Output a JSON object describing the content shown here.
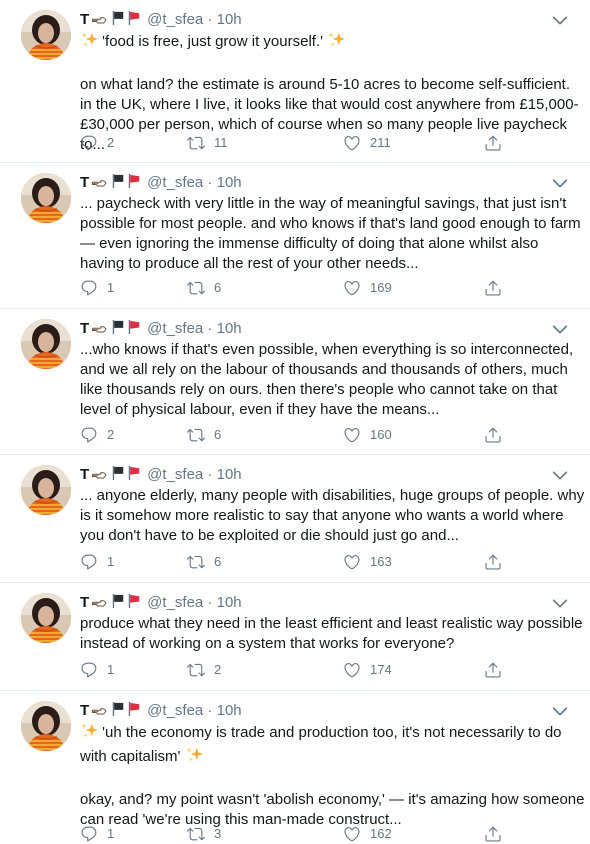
{
  "colors": {
    "text": "#14171a",
    "muted": "#657786",
    "divider": "#e6ecf0",
    "sparkle": "#ffcc4d",
    "flag_red": "#dd2e44",
    "flag_black": "#292f33"
  },
  "icons": {
    "reply": "reply-icon",
    "retweet": "retweet-icon",
    "like": "heart-icon",
    "share": "share-icon",
    "menu": "chevron-down-icon",
    "name_emoji": [
      "shooting-hand-emoji",
      "black-flag-emoji",
      "red-flag-emoji"
    ],
    "inline_emoji": "sparkles-emoji"
  },
  "tweets": [
    {
      "name": "T",
      "handle": "@t_sfea",
      "dot": "·",
      "time": "10h",
      "paragraphs": [
        "'food is free, just grow it yourself.'",
        "on what land? the estimate is around 5-10 acres to become self-sufficient. in the UK, where I live, it looks like that would cost anywhere from £15,000-£30,000 per person, which of course when so many people live paycheck to..."
      ],
      "replies": "2",
      "retweets": "11",
      "likes": "211"
    },
    {
      "name": "T",
      "handle": "@t_sfea",
      "dot": "·",
      "time": "10h",
      "paragraphs": [
        "... paycheck with very little in the way of meaningful savings, that just isn't possible for most people. and who knows if that's land good enough to farm — even ignoring the immense difficulty of doing that alone whilst also having to produce all the rest of your other needs..."
      ],
      "replies": "1",
      "retweets": "6",
      "likes": "169"
    },
    {
      "name": "T",
      "handle": "@t_sfea",
      "dot": "·",
      "time": "10h",
      "paragraphs": [
        "...who knows if that's even possible, when everything is so interconnected, and we all rely on the labour of thousands and thousands of others, much like thousands rely on ours. then there's people who cannot take on that level of physical labour, even if they have the means..."
      ],
      "replies": "2",
      "retweets": "6",
      "likes": "160"
    },
    {
      "name": "T",
      "handle": "@t_sfea",
      "dot": "·",
      "time": "10h",
      "paragraphs": [
        "... anyone elderly, many people with disabilities, huge groups of people. why is it somehow more realistic to say that anyone who wants a world where you don't have to be exploited or die should just go and..."
      ],
      "replies": "1",
      "retweets": "6",
      "likes": "163"
    },
    {
      "name": "T",
      "handle": "@t_sfea",
      "dot": "·",
      "time": "10h",
      "paragraphs": [
        "produce what they need in the least efficient and least realistic way possible instead of working on a system that works for everyone?"
      ],
      "replies": "1",
      "retweets": "2",
      "likes": "174"
    },
    {
      "name": "T",
      "handle": "@t_sfea",
      "dot": "·",
      "time": "10h",
      "paragraphs": [
        "'uh the economy is trade and production too, it's not necessarily to do with capitalism'",
        "okay, and? my point wasn't 'abolish economy,' — it's amazing how someone can read 'we're using this man-made construct..."
      ],
      "replies": "1",
      "retweets": "3",
      "likes": "162"
    }
  ]
}
